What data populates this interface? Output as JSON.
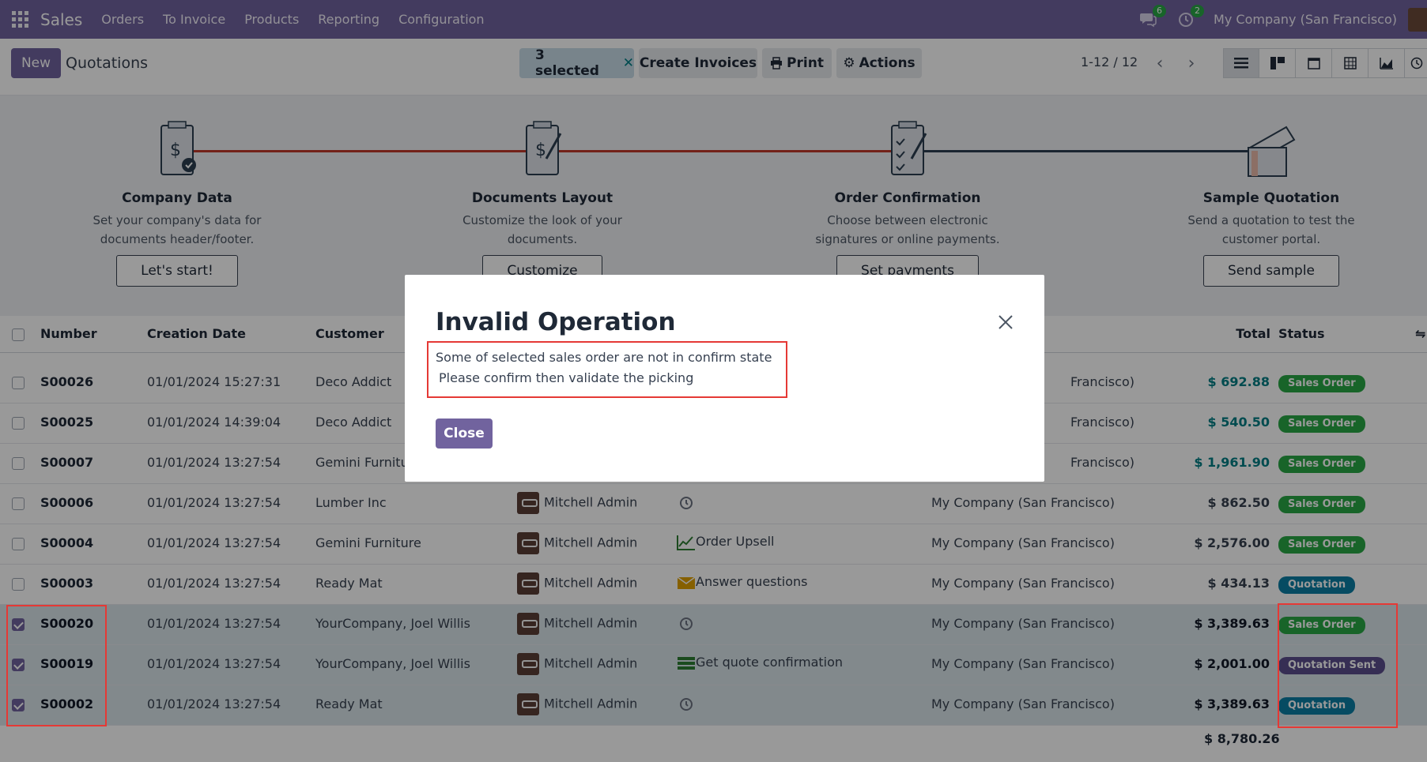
{
  "topbar": {
    "app_name": "Sales",
    "menu": [
      "Orders",
      "To Invoice",
      "Products",
      "Reporting",
      "Configuration"
    ],
    "messages_count": "6",
    "activities_count": "2",
    "company": "My Company (San Francisco)"
  },
  "control_panel": {
    "new_label": "New",
    "title": "Quotations",
    "selected_label": "3 selected",
    "create_invoices_label": "Create Invoices",
    "print_label": "Print",
    "actions_label": "Actions",
    "pager": "1-12 / 12"
  },
  "onboarding": {
    "steps": [
      {
        "title": "Company Data",
        "desc": "Set your company's data for documents header/footer.",
        "button": "Let's start!"
      },
      {
        "title": "Documents Layout",
        "desc": "Customize the look of your documents.",
        "button": "Customize"
      },
      {
        "title": "Order Confirmation",
        "desc": "Choose between electronic signatures or online payments.",
        "button": "Set payments"
      },
      {
        "title": "Sample Quotation",
        "desc": "Send a quotation to test the customer portal.",
        "button": "Send sample"
      }
    ]
  },
  "list": {
    "headers": {
      "number": "Number",
      "creation_date": "Creation Date",
      "customer": "Customer",
      "total": "Total",
      "status": "Status"
    },
    "rows": [
      {
        "number": "S00026",
        "date": "01/01/2024 15:27:31",
        "customer": "Deco Addict",
        "salesperson": "",
        "activity": "",
        "company": "Francisco)",
        "total": "$ 692.88",
        "status": "Sales Order",
        "selected": false
      },
      {
        "number": "S00025",
        "date": "01/01/2024 14:39:04",
        "customer": "Deco Addict",
        "salesperson": "",
        "activity": "",
        "company": "Francisco)",
        "total": "$ 540.50",
        "status": "Sales Order",
        "selected": false
      },
      {
        "number": "S00007",
        "date": "01/01/2024 13:27:54",
        "customer": "Gemini Furnitu",
        "salesperson": "",
        "activity": "",
        "company": "Francisco)",
        "total": "$ 1,961.90",
        "status": "Sales Order",
        "selected": false
      },
      {
        "number": "S00006",
        "date": "01/01/2024 13:27:54",
        "customer": "Lumber Inc",
        "salesperson": "Mitchell Admin",
        "activity": "",
        "company": "My Company (San Francisco)",
        "total": "$ 862.50",
        "status": "Sales Order",
        "selected": false
      },
      {
        "number": "S00004",
        "date": "01/01/2024 13:27:54",
        "customer": "Gemini Furniture",
        "salesperson": "Mitchell Admin",
        "activity": "Order Upsell",
        "company": "My Company (San Francisco)",
        "total": "$ 2,576.00",
        "status": "Sales Order",
        "selected": false
      },
      {
        "number": "S00003",
        "date": "01/01/2024 13:27:54",
        "customer": "Ready Mat",
        "salesperson": "Mitchell Admin",
        "activity": "Answer questions",
        "company": "My Company (San Francisco)",
        "total": "$ 434.13",
        "status": "Quotation",
        "selected": false
      },
      {
        "number": "S00020",
        "date": "01/01/2024 13:27:54",
        "customer": "YourCompany, Joel Willis",
        "salesperson": "Mitchell Admin",
        "activity": "",
        "company": "My Company (San Francisco)",
        "total": "$ 3,389.63",
        "status": "Sales Order",
        "selected": true
      },
      {
        "number": "S00019",
        "date": "01/01/2024 13:27:54",
        "customer": "YourCompany, Joel Willis",
        "salesperson": "Mitchell Admin",
        "activity": "Get quote confirmation",
        "company": "My Company (San Francisco)",
        "total": "$ 2,001.00",
        "status": "Quotation Sent",
        "selected": true
      },
      {
        "number": "S00002",
        "date": "01/01/2024 13:27:54",
        "customer": "Ready Mat",
        "salesperson": "Mitchell Admin",
        "activity": "",
        "company": "My Company (San Francisco)",
        "total": "$ 3,389.63",
        "status": "Quotation",
        "selected": true
      }
    ],
    "sum_total": "$ 8,780.26"
  },
  "dialog": {
    "title": "Invalid Operation",
    "message_line1": "Some of selected sales order are not in confirm state",
    "message_line2": "Please confirm then validate the picking",
    "close_label": "Close"
  },
  "colors": {
    "brand": "#71639e",
    "sales_order": "#28a745",
    "quotation": "#0a7ea4",
    "quotation_sent": "#5b4e8c",
    "highlight": "#e53935"
  }
}
